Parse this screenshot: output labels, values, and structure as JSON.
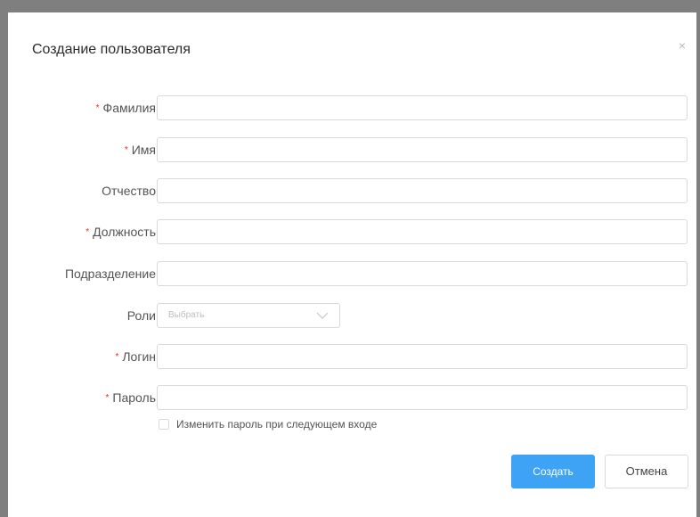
{
  "dialog": {
    "title": "Создание пользователя",
    "close_label": "×"
  },
  "form": {
    "fields": [
      {
        "label": "Фамилия",
        "required": true,
        "value": ""
      },
      {
        "label": "Имя",
        "required": true,
        "value": ""
      },
      {
        "label": "Отчество",
        "required": false,
        "value": ""
      },
      {
        "label": "Должность",
        "required": true,
        "value": ""
      },
      {
        "label": "Подразделение",
        "required": false,
        "value": ""
      },
      {
        "label": "Роли",
        "required": false,
        "placeholder": "Выбрать"
      },
      {
        "label": "Логин",
        "required": true,
        "value": ""
      },
      {
        "label": "Пароль",
        "required": true,
        "value": ""
      }
    ],
    "required_mark": "*",
    "change_password_checkbox": {
      "label": "Изменить пароль при следующем входе",
      "checked": false
    }
  },
  "actions": {
    "create_label": "Создать",
    "cancel_label": "Отмена"
  },
  "colors": {
    "primary": "#3fa3f5",
    "required": "#f5222d",
    "border": "#d9d9d9"
  },
  "icons": {
    "close": "close-icon",
    "dropdown": "chevron-down-icon"
  }
}
